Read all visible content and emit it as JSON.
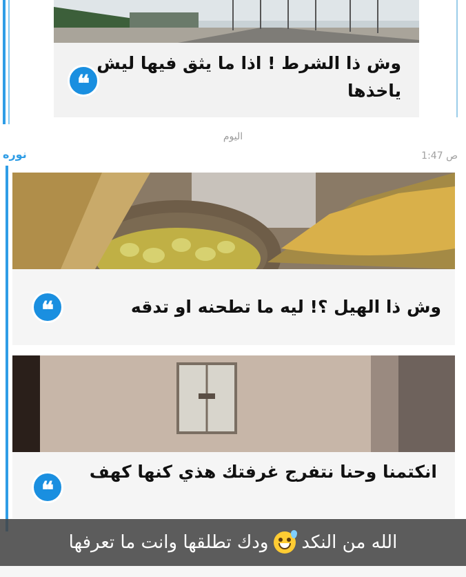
{
  "day_divider": "اليوم",
  "sender": "نوره",
  "time": "1:47 ص",
  "messages": [
    {
      "caption": "وش ذا الشرط ! اذا ما يثق فيها ليش ياخذها"
    },
    {
      "caption": "وش ذا الهيل ؟! ليه ما تطحنه او تدقه"
    },
    {
      "caption": "انكتمنا وحنا نتفرج غرفتك هذي كنها كهف"
    }
  ],
  "overlay_caption": {
    "before": "الله من النكد",
    "after": "ودك تطلقها وانت ما تعرفها",
    "emoji": "grinning-sweat-emoji"
  },
  "colors": {
    "accent": "#2f9de6",
    "badge": "#1a8fe0",
    "overlay": "#464646"
  }
}
